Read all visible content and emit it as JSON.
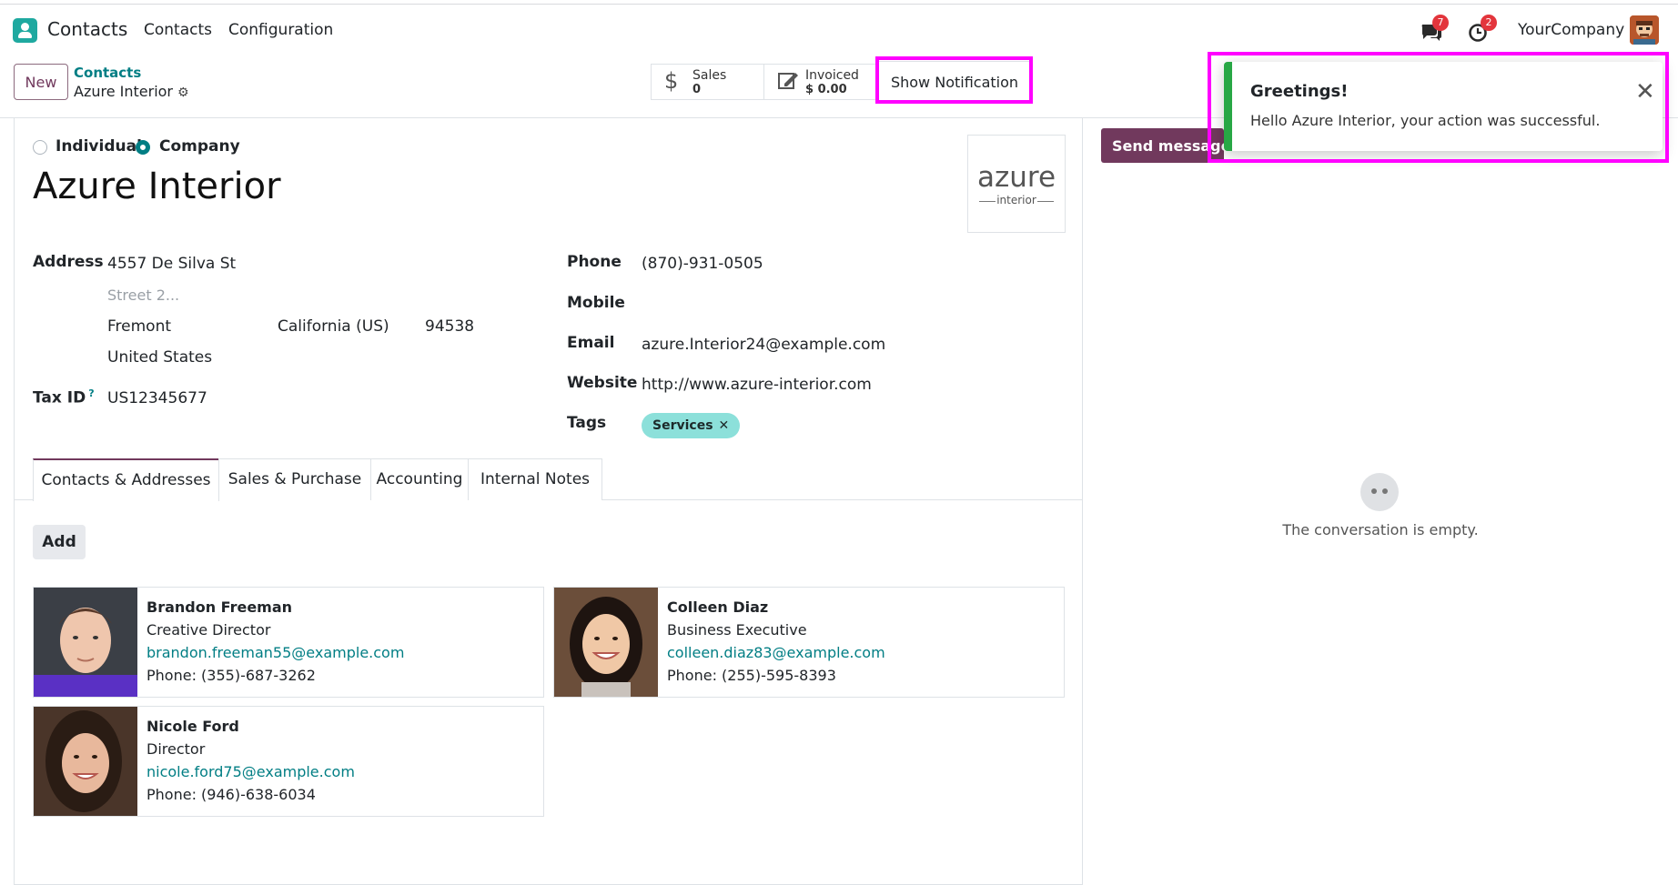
{
  "navbar": {
    "app_name": "Contacts",
    "menu": [
      "Contacts",
      "Configuration"
    ],
    "chat_icon": "chat-bubbles-icon",
    "chat_badge": "7",
    "activity_icon": "clock-icon",
    "activity_badge": "2",
    "company": "YourCompany"
  },
  "control": {
    "new_label": "New",
    "breadcrumb_parent": "Contacts",
    "breadcrumb_current": "Azure Interior",
    "stats": [
      {
        "label": "Sales",
        "value": "0",
        "icon": "dollar-icon"
      },
      {
        "label": "Invoiced",
        "value": "$ 0.00",
        "icon": "invoice-edit-icon"
      }
    ],
    "show_notification_label": "Show Notification"
  },
  "form": {
    "type_individual": "Individual",
    "type_company": "Company",
    "name": "Azure Interior",
    "logo_main": "azure",
    "logo_sub": "interior",
    "address_label": "Address",
    "street": "4557 De Silva St",
    "street2_placeholder": "Street 2...",
    "city": "Fremont",
    "state": "California (US)",
    "zip": "94538",
    "country": "United States",
    "tax_id_label": "Tax ID",
    "tax_id_help": "?",
    "tax_id": "US12345677",
    "phone_label": "Phone",
    "phone": "(870)-931-0505",
    "mobile_label": "Mobile",
    "email_label": "Email",
    "email": "azure.Interior24@example.com",
    "website_label": "Website",
    "website": "http://www.azure-interior.com",
    "tags_label": "Tags",
    "tag": "Services",
    "tag_remove": "✕"
  },
  "tabs": [
    "Contacts & Addresses",
    "Sales & Purchase",
    "Accounting",
    "Internal Notes"
  ],
  "add_label": "Add",
  "contacts": [
    {
      "name": "Brandon Freeman",
      "function": "Creative Director",
      "email": "brandon.freeman55@example.com",
      "phone": "Phone: (355)-687-3262"
    },
    {
      "name": "Colleen Diaz",
      "function": "Business Executive",
      "email": "colleen.diaz83@example.com",
      "phone": "Phone: (255)-595-8393"
    },
    {
      "name": "Nicole Ford",
      "function": "Director",
      "email": "nicole.ford75@example.com",
      "phone": "Phone: (946)-638-6034"
    }
  ],
  "chatter": {
    "send_message": "Send message",
    "empty": "The conversation is empty."
  },
  "toast": {
    "title": "Greetings!",
    "message": "Hello Azure Interior, your action was successful.",
    "close": "✕"
  },
  "colors": {
    "brand": "#71395d",
    "teal": "#017e84",
    "success": "#28a745",
    "highlight": "#ff00ff",
    "tag_bg": "#8ce0da"
  }
}
